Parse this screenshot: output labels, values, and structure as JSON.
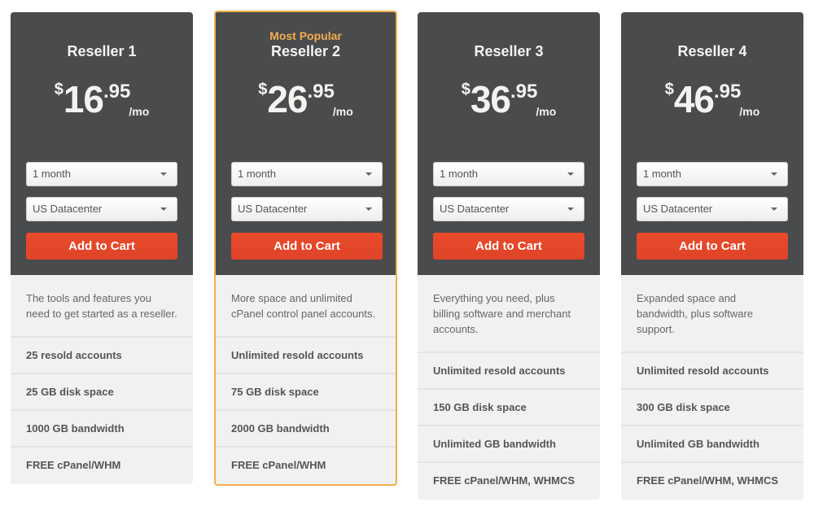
{
  "plans": [
    {
      "badge": "",
      "name": "Reseller 1",
      "price": {
        "currency": "$",
        "integer": "16",
        "decimal": ".95",
        "period": "/mo"
      },
      "term_select": "1 month",
      "datacenter_select": "US Datacenter",
      "cart_label": "Add to Cart",
      "description": "The tools and features you need to get started as a reseller.",
      "features": [
        "25 resold accounts",
        "25 GB disk space",
        "1000 GB bandwidth",
        "FREE cPanel/WHM"
      ]
    },
    {
      "badge": "Most Popular",
      "name": "Reseller 2",
      "price": {
        "currency": "$",
        "integer": "26",
        "decimal": ".95",
        "period": "/mo"
      },
      "term_select": "1 month",
      "datacenter_select": "US Datacenter",
      "cart_label": "Add to Cart",
      "description": "More space and unlimited cPanel control panel accounts.",
      "features": [
        "Unlimited resold accounts",
        "75 GB disk space",
        "2000 GB bandwidth",
        "FREE cPanel/WHM"
      ]
    },
    {
      "badge": "",
      "name": "Reseller 3",
      "price": {
        "currency": "$",
        "integer": "36",
        "decimal": ".95",
        "period": "/mo"
      },
      "term_select": "1 month",
      "datacenter_select": "US Datacenter",
      "cart_label": "Add to Cart",
      "description": "Everything you need, plus billing software and merchant accounts.",
      "features": [
        "Unlimited resold accounts",
        "150 GB disk space",
        "Unlimited GB bandwidth",
        "FREE cPanel/WHM, WHMCS"
      ]
    },
    {
      "badge": "",
      "name": "Reseller 4",
      "price": {
        "currency": "$",
        "integer": "46",
        "decimal": ".95",
        "period": "/mo"
      },
      "term_select": "1 month",
      "datacenter_select": "US Datacenter",
      "cart_label": "Add to Cart",
      "description": "Expanded space and bandwidth, plus software support.",
      "features": [
        "Unlimited resold accounts",
        "300 GB disk space",
        "Unlimited GB bandwidth",
        "FREE cPanel/WHM, WHMCS"
      ]
    }
  ],
  "colors": {
    "header_bg": "#4a4b4d",
    "accent_featured": "#f4ad4f",
    "cart_button": "#e24629",
    "body_bg": "#f1f1f1"
  }
}
